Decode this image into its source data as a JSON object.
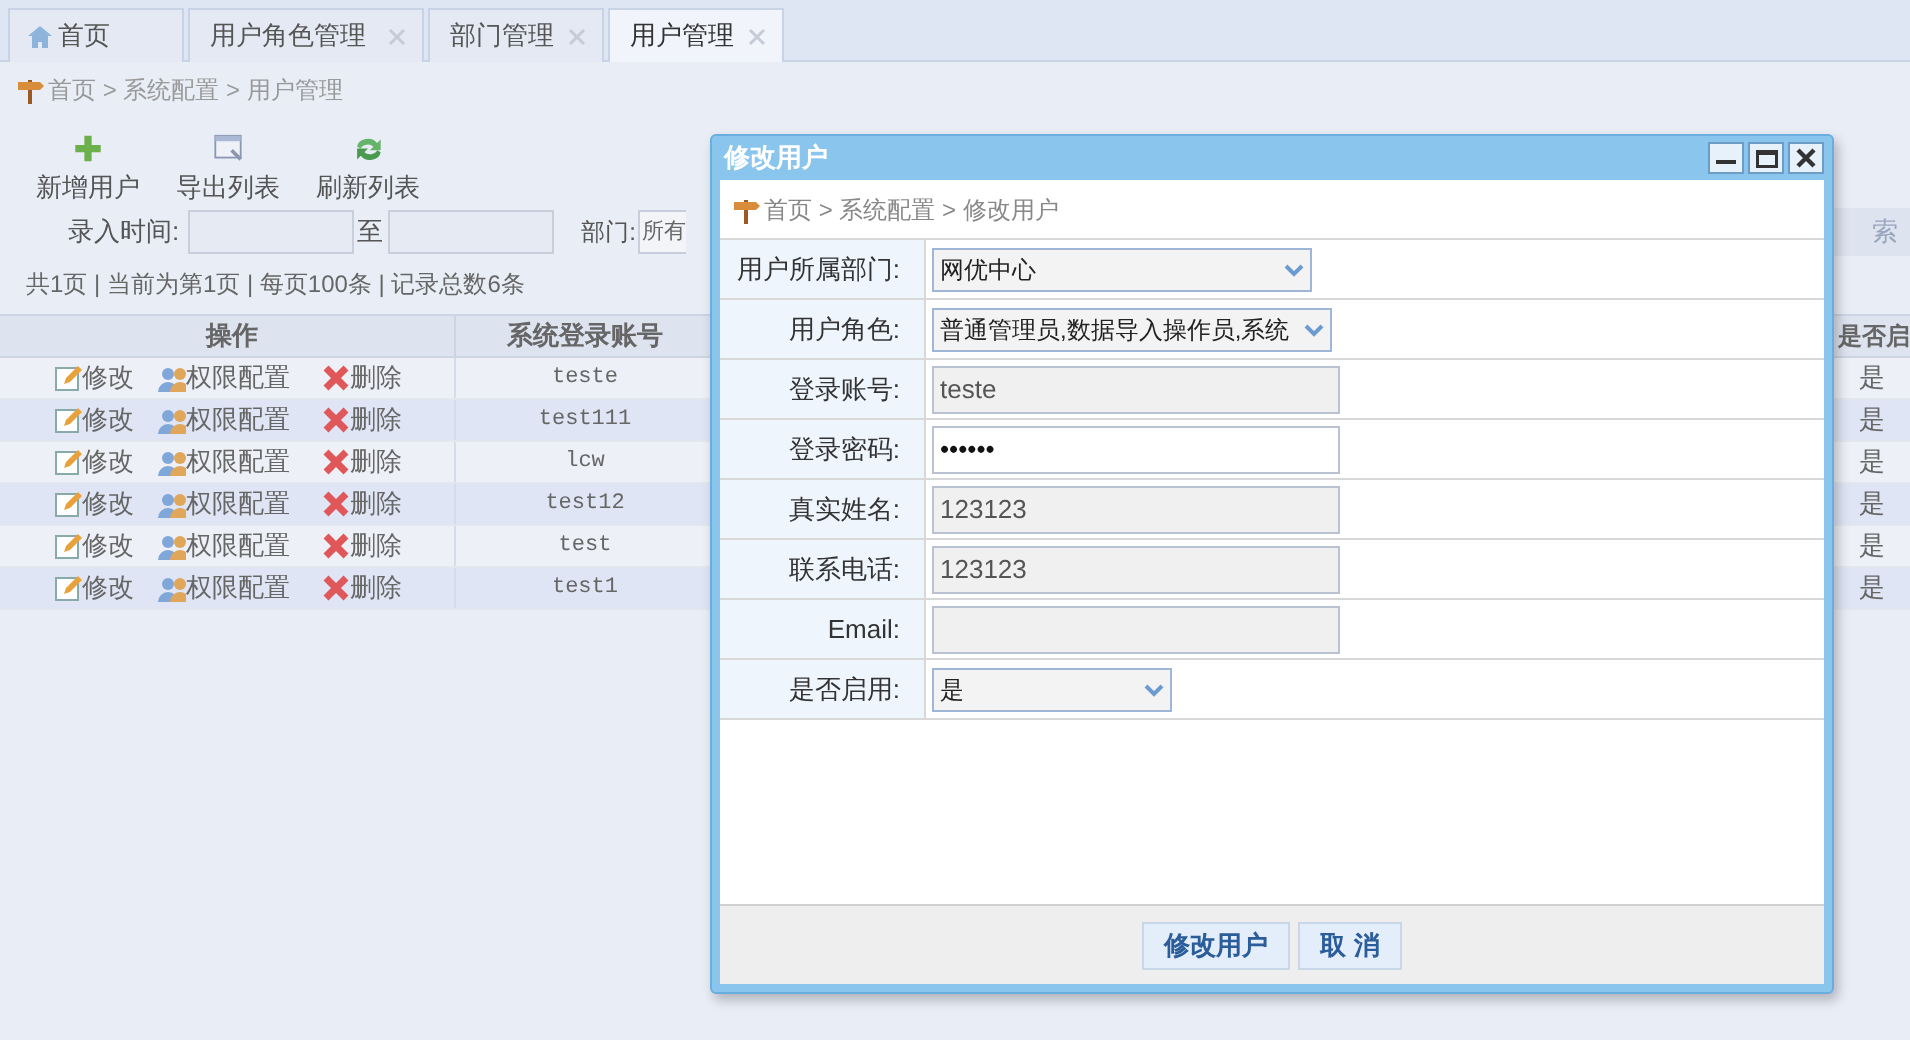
{
  "tabs": [
    {
      "kind": "home",
      "label": "首页",
      "closable": false,
      "selected": false
    },
    {
      "kind": "page",
      "label": "用户角色管理",
      "closable": true,
      "selected": false
    },
    {
      "kind": "page",
      "label": "部门管理",
      "closable": true,
      "selected": false
    },
    {
      "kind": "page",
      "label": "用户管理",
      "closable": true,
      "selected": true
    }
  ],
  "breadcrumb": "首页 > 系统配置 > 用户管理",
  "toolbar": [
    {
      "kind": "add",
      "label": "新增用户"
    },
    {
      "kind": "export",
      "label": "导出列表"
    },
    {
      "kind": "refresh",
      "label": "刷新列表"
    }
  ],
  "filters": {
    "time_label": "录入时间:",
    "to_label": "至",
    "dept_label": "部门:",
    "dept_value": "所有",
    "search_button": "索"
  },
  "pagination": "共1页 | 当前为第1页 | 每页100条 | 记录总数6条",
  "table": {
    "columns": [
      "操作",
      "系统登录账号",
      "是否启"
    ],
    "rows": [
      {
        "actions": [
          {
            "kind": "edit",
            "label": "修改"
          },
          {
            "kind": "perm",
            "label": "权限配置"
          },
          {
            "kind": "delete",
            "label": "删除"
          }
        ],
        "account": "teste",
        "enabled": "是"
      },
      {
        "actions": [
          {
            "kind": "edit",
            "label": "修改"
          },
          {
            "kind": "perm",
            "label": "权限配置"
          },
          {
            "kind": "delete",
            "label": "删除"
          }
        ],
        "account": "test111",
        "enabled": "是"
      },
      {
        "actions": [
          {
            "kind": "edit",
            "label": "修改"
          },
          {
            "kind": "perm",
            "label": "权限配置"
          },
          {
            "kind": "delete",
            "label": "删除"
          }
        ],
        "account": "lcw",
        "enabled": "是"
      },
      {
        "actions": [
          {
            "kind": "edit",
            "label": "修改"
          },
          {
            "kind": "perm",
            "label": "权限配置"
          },
          {
            "kind": "delete",
            "label": "删除"
          }
        ],
        "account": "test12",
        "enabled": "是"
      },
      {
        "actions": [
          {
            "kind": "edit",
            "label": "修改"
          },
          {
            "kind": "perm",
            "label": "权限配置"
          },
          {
            "kind": "delete",
            "label": "删除"
          }
        ],
        "account": "test",
        "enabled": "是"
      },
      {
        "actions": [
          {
            "kind": "edit",
            "label": "修改"
          },
          {
            "kind": "perm",
            "label": "权限配置"
          },
          {
            "kind": "delete",
            "label": "删除"
          }
        ],
        "account": "test1",
        "enabled": "是"
      }
    ]
  },
  "dialog": {
    "title": "修改用户",
    "breadcrumb": "首页 > 系统配置 > 修改用户",
    "fields": [
      {
        "kind": "select",
        "label": "用户所属部门:",
        "value": "网优中心"
      },
      {
        "kind": "select",
        "label": "用户角色:",
        "value": "普通管理员,数据导入操作员,系统"
      },
      {
        "kind": "input",
        "label": "登录账号:",
        "value": "teste",
        "readonly": true
      },
      {
        "kind": "input",
        "label": "登录密码:",
        "value": "••••••",
        "readonly": false
      },
      {
        "kind": "input",
        "label": "真实姓名:",
        "value": "123123",
        "readonly": true
      },
      {
        "kind": "input",
        "label": "联系电话:",
        "value": "123123",
        "readonly": true
      },
      {
        "kind": "input",
        "label": "Email:",
        "readonly": true
      },
      {
        "kind": "select",
        "label": "是否启用:",
        "value": "是"
      }
    ],
    "buttons": [
      "修改用户",
      "取 消"
    ]
  }
}
